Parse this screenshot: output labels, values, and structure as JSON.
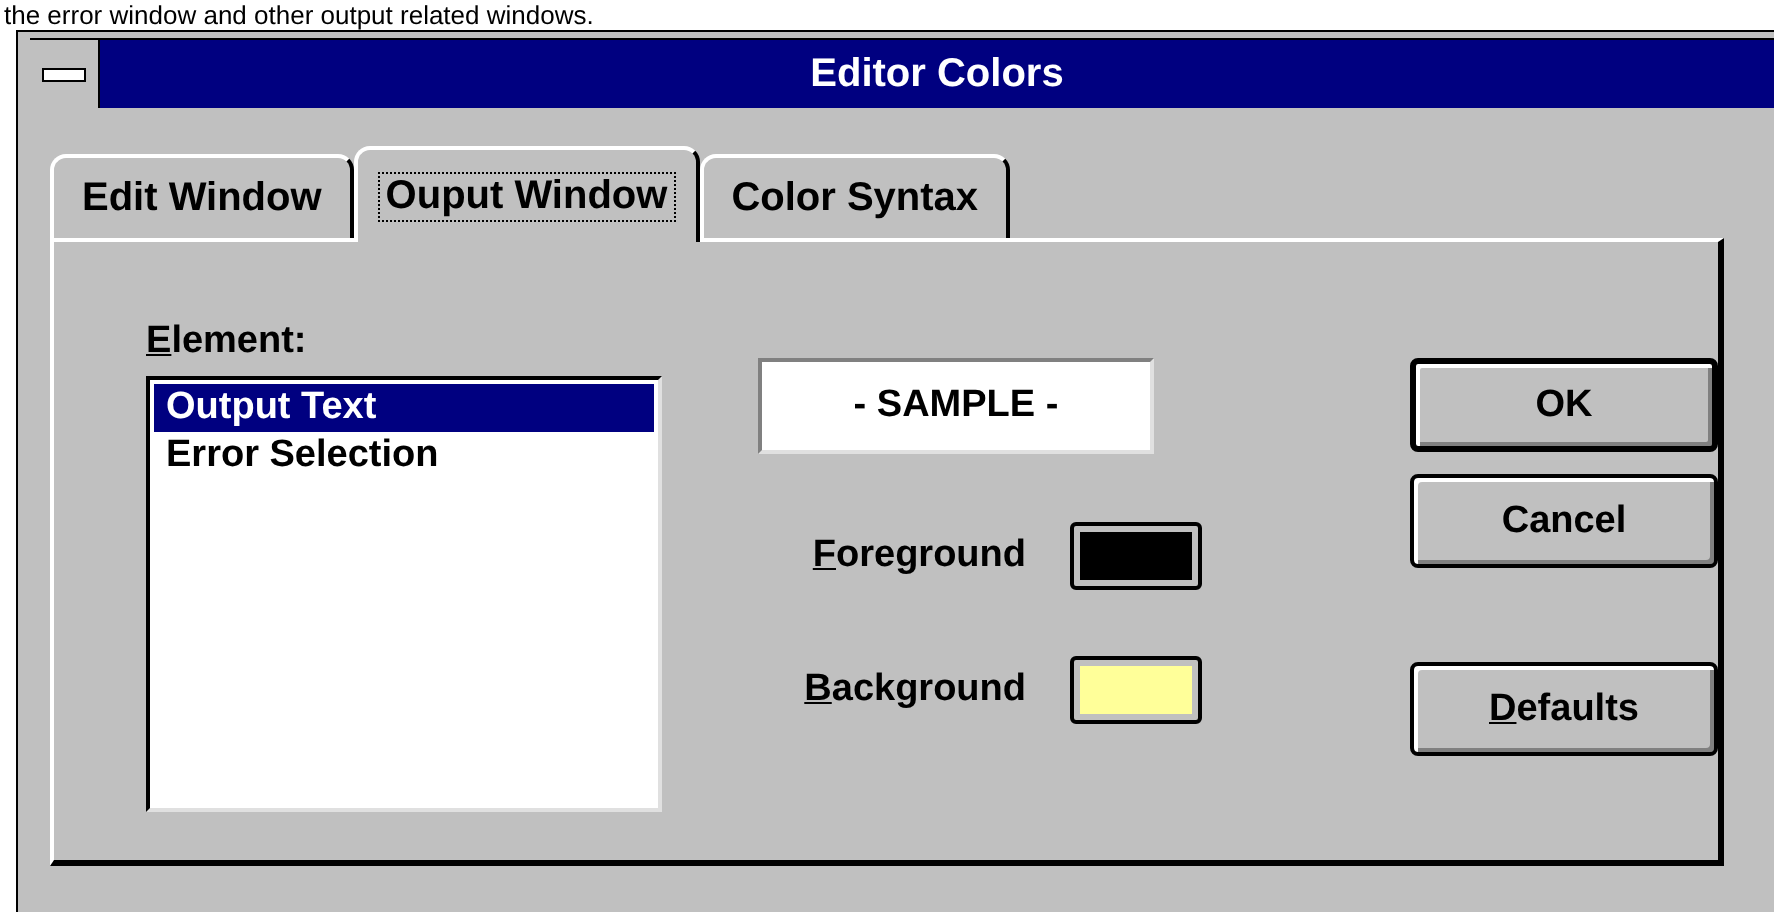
{
  "caption": "the error window and other output related windows.",
  "window": {
    "title": "Editor Colors"
  },
  "tabs": [
    {
      "label": "Edit Window",
      "selected": false
    },
    {
      "label": "Ouput Window",
      "selected": true
    },
    {
      "label": "Color Syntax",
      "selected": false
    }
  ],
  "element_list": {
    "label": "Element:",
    "underline_first": true,
    "items": [
      {
        "label": "Output Text",
        "selected": true
      },
      {
        "label": "Error Selection",
        "selected": false
      }
    ]
  },
  "sample": "- SAMPLE -",
  "colors": [
    {
      "label": "Foreground",
      "underline_first": true,
      "color": "#000000"
    },
    {
      "label": "Background",
      "underline_first": true,
      "color": "#ffff99"
    }
  ],
  "buttons": [
    {
      "label": "OK",
      "default": true,
      "underline_first": false
    },
    {
      "label": "Cancel",
      "default": false,
      "underline_first": false
    },
    {
      "label": "Defaults",
      "default": false,
      "underline_first": true
    }
  ]
}
